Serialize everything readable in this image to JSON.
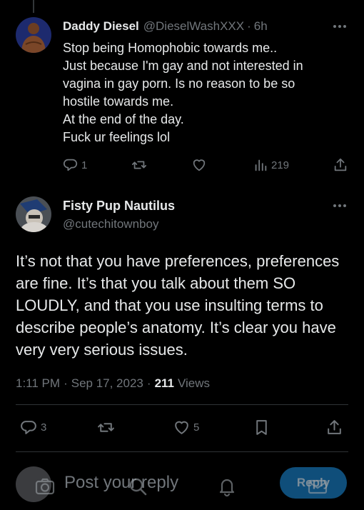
{
  "parent_tweet": {
    "display_name": "Daddy Diesel",
    "handle": "@DieselWashXXX",
    "separator": "·",
    "time": "6h",
    "text_lines": [
      "Stop being Homophobic towards me..",
      "Just because I'm gay and not interested in",
      "vagina in gay porn. Is no reason to be so",
      "hostile towards me.",
      "At the end of the day.",
      "Fuck ur feelings lol"
    ],
    "reply_count": "1",
    "views": "219"
  },
  "main_tweet": {
    "display_name": "Fisty Pup Nautilus",
    "handle": "@cutechitownboy",
    "text_lines": [
      "It’s not that you have preferences, preferences",
      "are fine.  It’s that you talk about them SO",
      "LOUDLY, and that you use insulting terms to",
      "describe people’s anatomy.  It’s clear you have",
      "very very serious issues."
    ],
    "time": "1:11 PM",
    "sep1": "·",
    "date": "Sep 17, 2023",
    "sep2": "·",
    "view_count": "211",
    "views_label": "Views",
    "reply_count": "3",
    "like_count": "5"
  },
  "composer": {
    "placeholder": "Post your reply",
    "reply_button": "Reply"
  },
  "colors": {
    "background": "#000000",
    "text_primary": "#e7e9ea",
    "text_secondary": "#71767b",
    "divider": "#2f3336",
    "reply_button": "#0f4e7a"
  },
  "icons": [
    "more-icon",
    "reply-icon",
    "repost-icon",
    "like-icon",
    "views-icon",
    "share-icon",
    "bookmark-icon",
    "camera-icon",
    "search-icon",
    "bell-icon",
    "mail-icon"
  ]
}
